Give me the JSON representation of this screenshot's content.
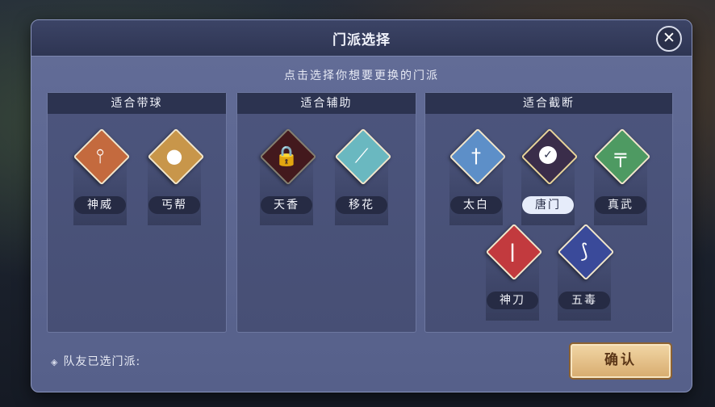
{
  "dialog": {
    "title": "门派选择",
    "subtitle": "点击选择你想要更换的门派",
    "close_icon": "close-icon"
  },
  "groups": [
    {
      "heading": "适合带球",
      "heroes": [
        {
          "name": "神威",
          "color": "#c46a3e",
          "icon": "spear-icon",
          "state": "available"
        },
        {
          "name": "丐帮",
          "color": "#c8964a",
          "icon": "gourd-icon",
          "state": "available"
        }
      ]
    },
    {
      "heading": "适合辅助",
      "heroes": [
        {
          "name": "天香",
          "color": "#7a2e34",
          "icon": "lock-icon",
          "state": "locked"
        },
        {
          "name": "移花",
          "color": "#6ab8c0",
          "icon": "flute-icon",
          "state": "available"
        }
      ]
    },
    {
      "heading": "适合截断",
      "heroes": [
        {
          "name": "太白",
          "color": "#5d8fc8",
          "icon": "sword-icon",
          "state": "available"
        },
        {
          "name": "唐门",
          "color": "#3a2d4a",
          "icon": "check-icon",
          "state": "selected"
        },
        {
          "name": "真武",
          "color": "#4e9a62",
          "icon": "sword-icon",
          "state": "available"
        },
        {
          "name": "神刀",
          "color": "#c23a3e",
          "icon": "blade-icon",
          "state": "available"
        },
        {
          "name": "五毒",
          "color": "#3a4a9a",
          "icon": "claw-icon",
          "state": "available"
        }
      ]
    }
  ],
  "footer": {
    "teammates_label": "队友已选门派:",
    "confirm_label": "确认"
  }
}
